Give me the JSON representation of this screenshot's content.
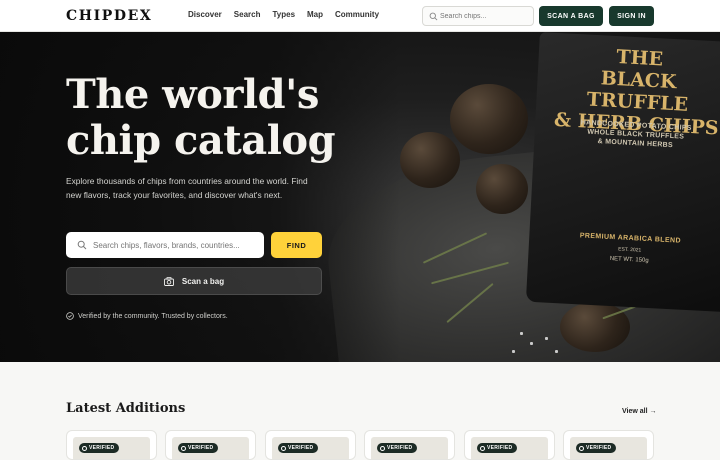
{
  "nav": {
    "logo": "CHIPDEX",
    "links": [
      "Discover",
      "Search",
      "Types",
      "Map",
      "Community"
    ],
    "search_placeholder": "Search chips...",
    "scan_label": "SCAN A BAG",
    "signin_label": "SIGN IN"
  },
  "hero": {
    "title_line1": "The world's",
    "title_line2": "chip catalog",
    "description": "Explore thousands of chips from countries around the world. Find new flavors, track your favorites, and discover what's next.",
    "search_placeholder": "Search chips, flavors, brands, countries...",
    "find_label": "FIND",
    "scan_label": "Scan a bag",
    "verified_text": "Verified by the community. Trusted by collectors.",
    "product": {
      "title": "BLACK TRUFFLE & HERB CHIPS",
      "title_line1": "THE",
      "title_line2": "BLACK TRUFFLE",
      "title_line3": "& HERB CHIPS",
      "sub_line1": "HANDCOOKED POTATO CHIPS",
      "sub_line2": "WHOLE BLACK TRUFFLES",
      "sub_line3": "& MOUNTAIN HERBS",
      "blend": "PREMIUM ARABICA BLEND",
      "est": "EST. 2021",
      "weight": "NET WT. 150g"
    }
  },
  "latest": {
    "title": "Latest Additions",
    "view_all": "View all →",
    "cards": [
      {
        "badge": "VERIFIED"
      },
      {
        "badge": "VERIFIED"
      },
      {
        "badge": "VERIFIED"
      },
      {
        "badge": "VERIFIED"
      },
      {
        "badge": "VERIFIED"
      },
      {
        "badge": "VERIFIED"
      }
    ]
  },
  "colors": {
    "accent_dark_green": "#18392d",
    "accent_yellow": "#ffd23a",
    "hero_bg": "#141414",
    "gold": "#d8b46a"
  }
}
